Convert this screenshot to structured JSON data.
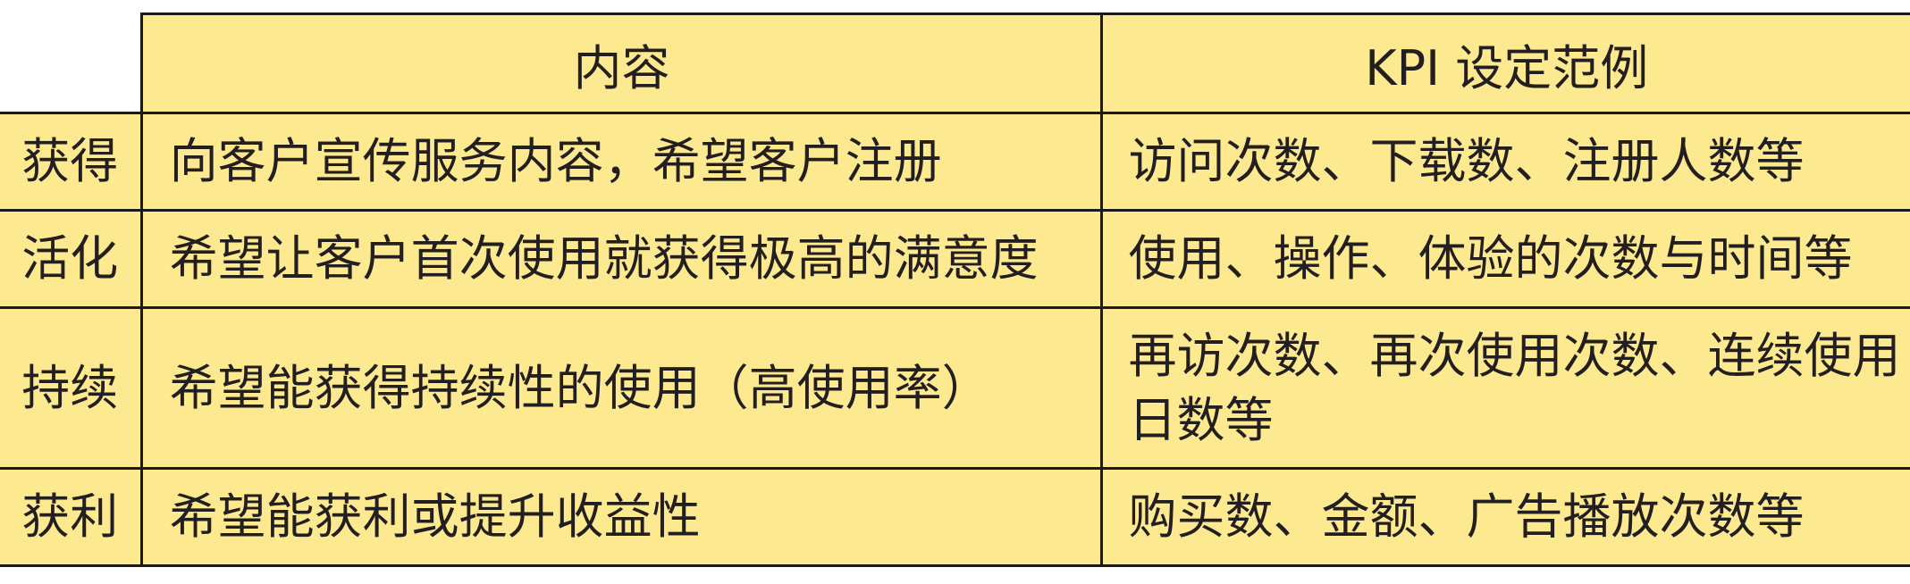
{
  "header": {
    "col_content": "内容",
    "col_kpi": "KPI 设定范例"
  },
  "rows": [
    {
      "stage": "获得",
      "content": "向客户宣传服务内容，希望客户注册",
      "kpi": "访问次数、下载数、注册人数等"
    },
    {
      "stage": "活化",
      "content": "希望让客户首次使用就获得极高的满意度",
      "kpi": "使用、操作、体验的次数与时间等"
    },
    {
      "stage": "持续",
      "content": "希望能获得持续性的使用（高使用率）",
      "kpi": "再访次数、再次使用次数、连续使用日数等"
    },
    {
      "stage": "获利",
      "content": "希望能获利或提升收益性",
      "kpi": "购买数、金额、广告播放次数等"
    }
  ],
  "colors": {
    "cell_background": "#fde98f",
    "border": "#1a1a1a"
  }
}
